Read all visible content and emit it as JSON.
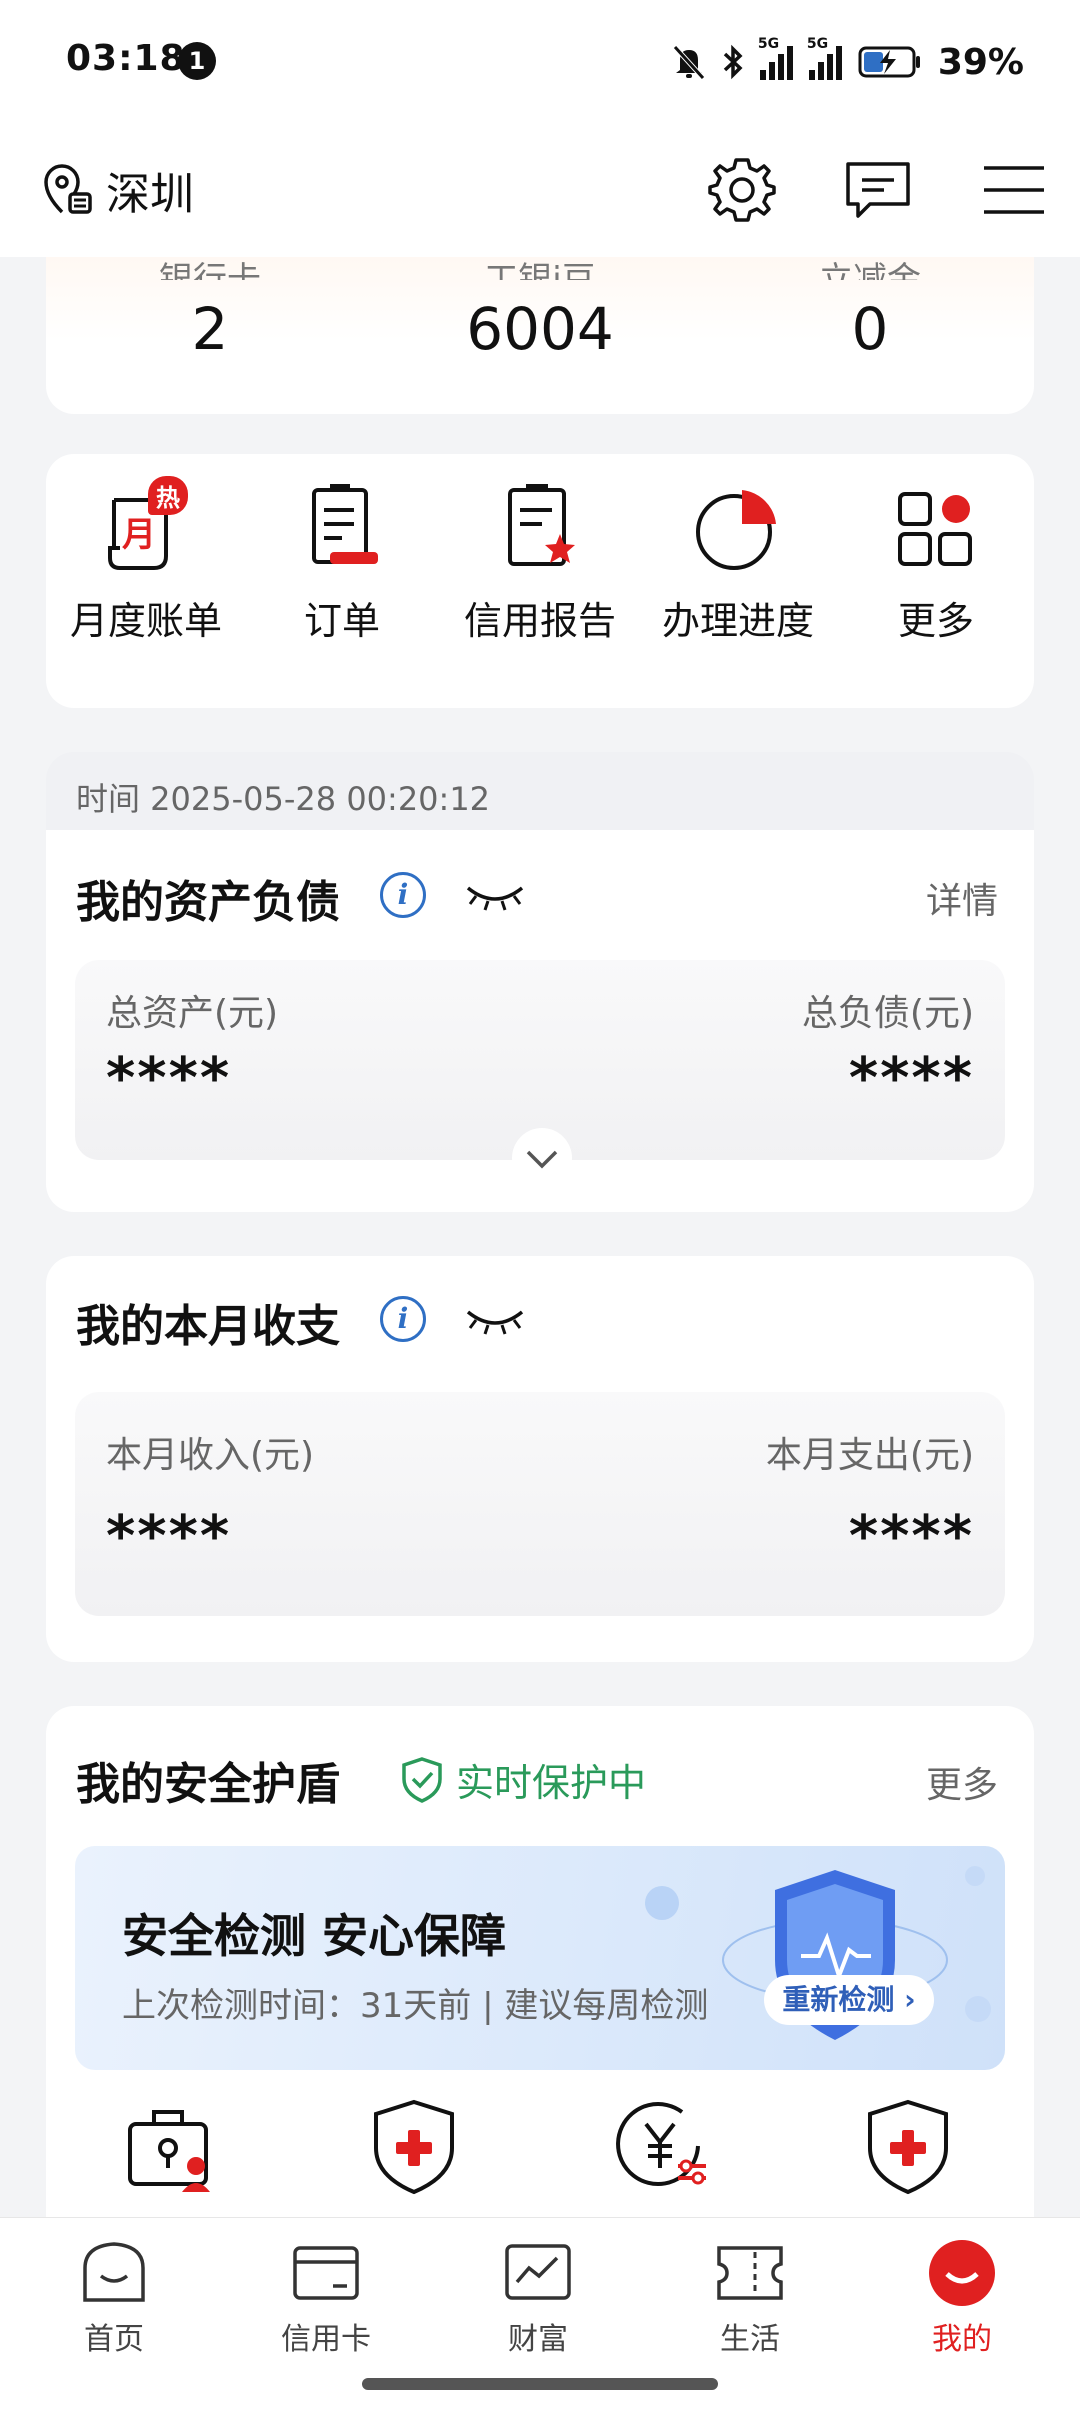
{
  "status_bar": {
    "time": "03:18",
    "notification_count": "1",
    "network_1": "5G",
    "network_2": "5G",
    "battery": "39%"
  },
  "header": {
    "city": "深圳"
  },
  "stats": [
    {
      "label": "银行卡",
      "value": "2"
    },
    {
      "label": "工银i豆",
      "value": "6004"
    },
    {
      "label": "立减金",
      "value": "0"
    }
  ],
  "quick_actions": [
    {
      "label": "月度账单",
      "badge": "热",
      "icon": "monthly-bill-icon"
    },
    {
      "label": "订单",
      "icon": "order-icon"
    },
    {
      "label": "信用报告",
      "icon": "credit-report-icon"
    },
    {
      "label": "办理进度",
      "icon": "progress-pie-icon"
    },
    {
      "label": "更多",
      "icon": "more-grid-icon"
    }
  ],
  "timestamp": "时间 2025-05-28 00:20:12",
  "assets": {
    "title": "我的资产负债",
    "detail": "详情",
    "total_assets_label": "总资产(元)",
    "total_assets_value": "****",
    "total_liabilities_label": "总负债(元)",
    "total_liabilities_value": "****"
  },
  "income": {
    "title": "我的本月收支",
    "income_label": "本月收入(元)",
    "income_value": "****",
    "expense_label": "本月支出(元)",
    "expense_value": "****"
  },
  "shield": {
    "title": "我的安全护盾",
    "status": "实时保护中",
    "more": "更多",
    "banner_title": "安全检测 安心保障",
    "banner_sub": "上次检测时间：31天前 | 建议每周检测",
    "recheck": "重新检测"
  },
  "bottom_nav": [
    {
      "label": "首页",
      "icon": "home-icon"
    },
    {
      "label": "信用卡",
      "icon": "credit-card-icon"
    },
    {
      "label": "财富",
      "icon": "wealth-chart-icon"
    },
    {
      "label": "生活",
      "icon": "life-ticket-icon"
    },
    {
      "label": "我的",
      "icon": "profile-icon",
      "active": true
    }
  ],
  "colors": {
    "accent_red": "#e02020",
    "info_blue": "#2f6fc4",
    "safe_green": "#2a9a5a"
  }
}
